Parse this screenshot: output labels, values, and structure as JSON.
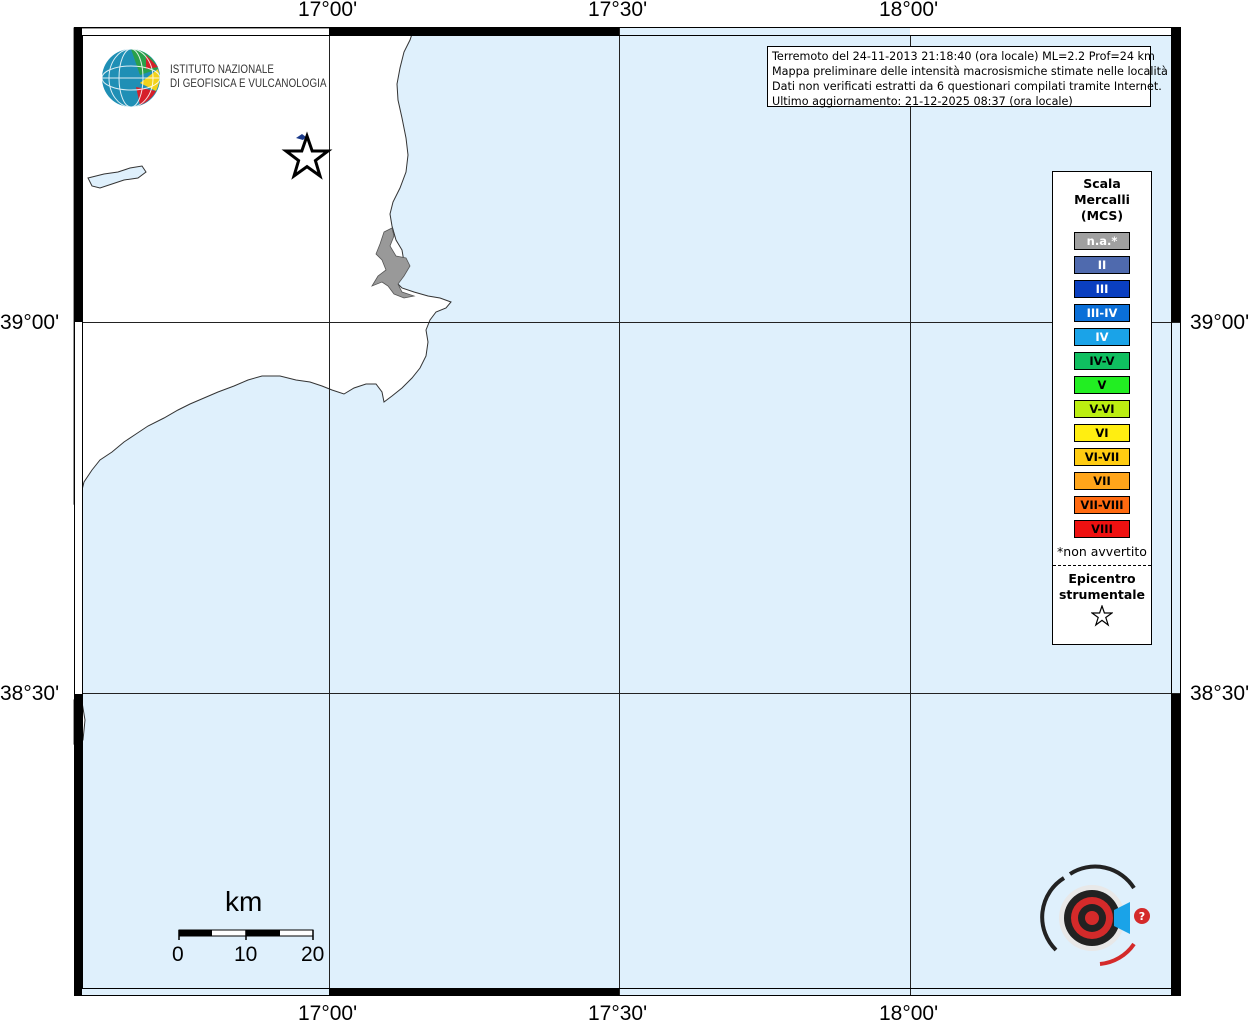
{
  "map": {
    "lon_labels": [
      "17°00'",
      "17°30'",
      "18°00'"
    ],
    "lat_labels": [
      "39°00'",
      "38°30'"
    ],
    "colors": {
      "sea": "#dff0fc",
      "land": "#ffffff",
      "lake": "#999999"
    }
  },
  "info": {
    "line1": "Terremoto del 24-11-2013 21:18:40 (ora locale) ML=2.2 Prof=24 km",
    "line2": "Mappa preliminare delle intensità macrosismiche stimate nelle località",
    "line3": "Dati non verificati estratti da 6 questionari compilati tramite Internet.",
    "line4": "Ultimo aggiornamento: 21-12-2025 08:37 (ora locale)"
  },
  "legend": {
    "title1": "Scala",
    "title2": "Mercalli",
    "title3": "(MCS)",
    "items": [
      {
        "label": "n.a.*",
        "color": "#a0a0a0",
        "text_color": "#ffffff"
      },
      {
        "label": "II",
        "color": "#4f6aae",
        "text_color": "#ffffff"
      },
      {
        "label": "III",
        "color": "#0a3fc0",
        "text_color": "#ffffff"
      },
      {
        "label": "III-IV",
        "color": "#0a6fd8",
        "text_color": "#ffffff"
      },
      {
        "label": "IV",
        "color": "#1aa3e8",
        "text_color": "#ffffff"
      },
      {
        "label": "IV-V",
        "color": "#0fbf60",
        "text_color": "#000000"
      },
      {
        "label": "V",
        "color": "#22ee22",
        "text_color": "#000000"
      },
      {
        "label": "V-VI",
        "color": "#bbee11",
        "text_color": "#000000"
      },
      {
        "label": "VI",
        "color": "#ffee11",
        "text_color": "#000000"
      },
      {
        "label": "VI-VII",
        "color": "#ffcc11",
        "text_color": "#000000"
      },
      {
        "label": "VII",
        "color": "#ffa51a",
        "text_color": "#000000"
      },
      {
        "label": "VII-VIII",
        "color": "#ff6a10",
        "text_color": "#000000"
      },
      {
        "label": "VIII",
        "color": "#ee1111",
        "text_color": "#000000"
      }
    ],
    "note": "*non avvertito",
    "epicenter1": "Epicentro",
    "epicenter2": "strumentale"
  },
  "logo": {
    "line1": "ISTITUTO NAZIONALE",
    "line2": "DI GEOFISICA E VULCANOLOGIA"
  },
  "scale_bar": {
    "unit": "km",
    "labels": [
      "0",
      "10",
      "20"
    ]
  }
}
